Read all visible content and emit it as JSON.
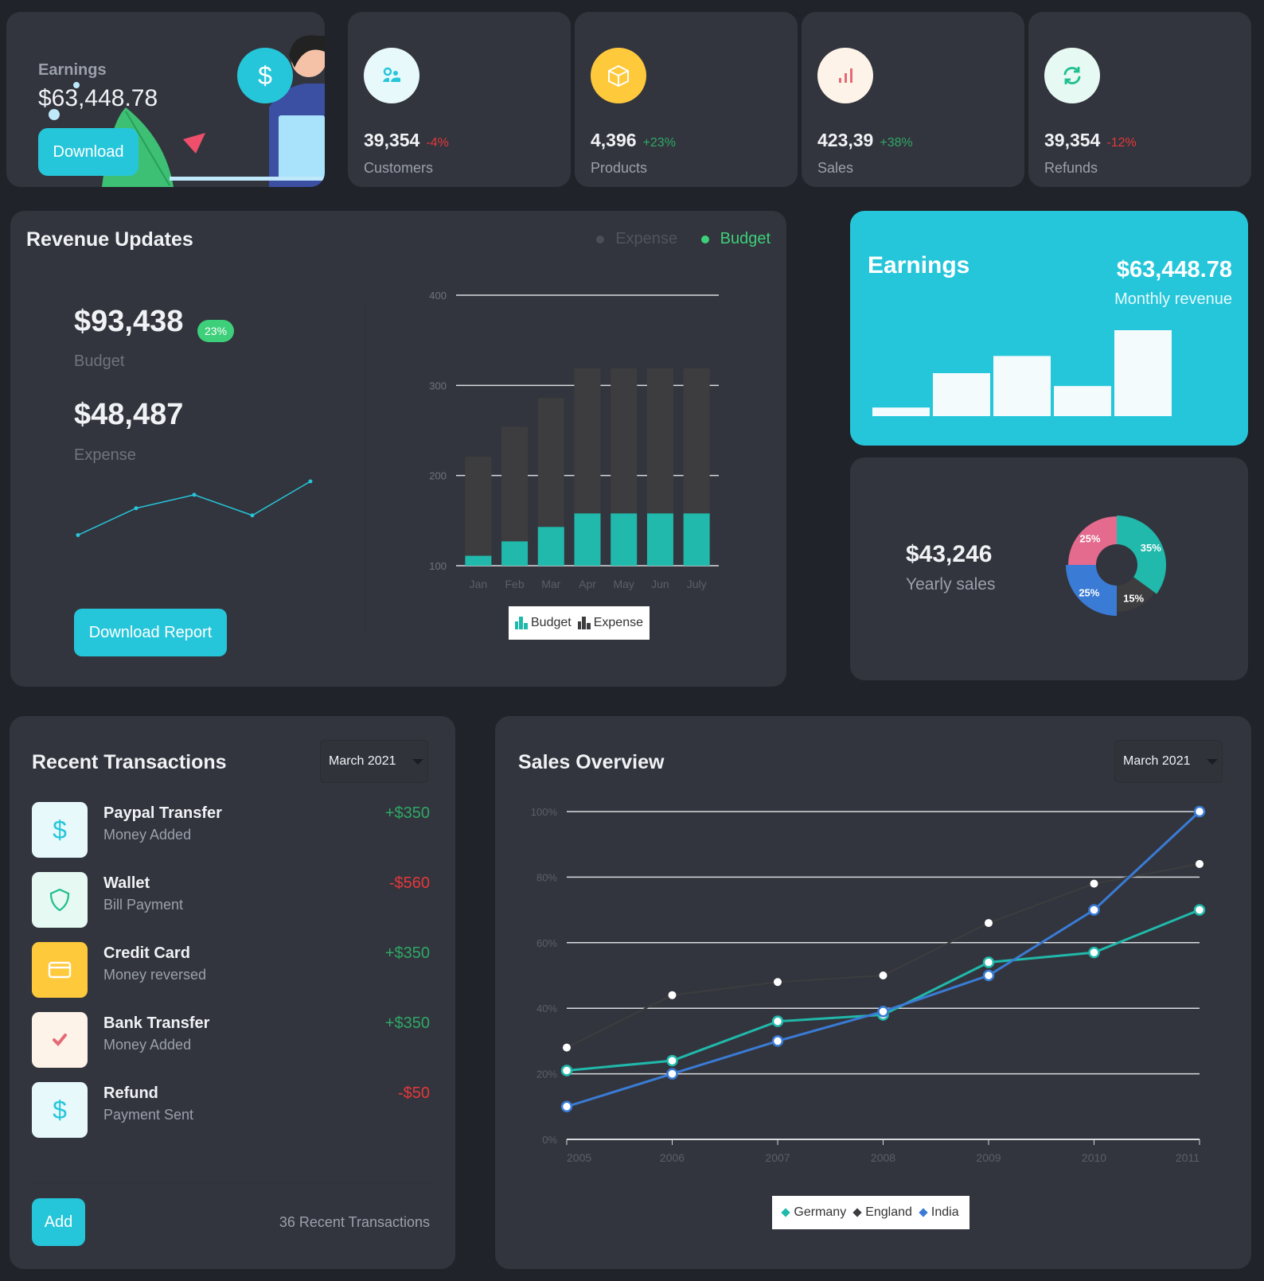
{
  "earnings_card": {
    "label": "Earnings",
    "value": "$63,448.78",
    "button": "Download",
    "icon": "dollar-icon"
  },
  "stats": [
    {
      "value": "39,354",
      "change": "-4%",
      "trend": "down",
      "label": "Customers",
      "icon": "users-icon",
      "icon_bg": "#e8f9fc",
      "icon_color": "#26c6da"
    },
    {
      "value": "4,396",
      "change": "+23%",
      "trend": "up",
      "label": "Products",
      "icon": "box-icon",
      "icon_bg": "#ffc93c",
      "icon_color": "#ffffff"
    },
    {
      "value": "423,39",
      "change": "+38%",
      "trend": "up",
      "label": "Sales",
      "icon": "bar-chart-icon",
      "icon_bg": "#fef3e8",
      "icon_color": "#e46a76"
    },
    {
      "value": "39,354",
      "change": "-12%",
      "trend": "down",
      "label": "Refunds",
      "icon": "refresh-icon",
      "icon_bg": "#e6f9f2",
      "icon_color": "#1fbf8f"
    }
  ],
  "revenue": {
    "title": "Revenue Updates",
    "legend_top": [
      {
        "label": "Expense",
        "color": "#4a4f57"
      },
      {
        "label": "Budget",
        "color": "#3ecf7a"
      }
    ],
    "budget_value": "$93,438",
    "budget_badge": "23%",
    "budget_label": "Budget",
    "expense_value": "$48,487",
    "expense_label": "Expense",
    "button": "Download Report"
  },
  "earnings_monthly": {
    "title": "Earnings",
    "value": "$63,448.78",
    "subtitle": "Monthly revenue"
  },
  "yearly": {
    "value": "$43,246",
    "label": "Yearly sales"
  },
  "transactions": {
    "title": "Recent Transactions",
    "period": "March 2021",
    "items": [
      {
        "name": "Paypal Transfer",
        "sub": "Money Added",
        "amount": "+$350",
        "type": "credit",
        "icon": "dollar-icon",
        "icon_bg": "#e8f9fc",
        "icon_color": "#26c6da"
      },
      {
        "name": "Wallet",
        "sub": "Bill Payment",
        "amount": "-$560",
        "type": "debit",
        "icon": "shield-icon",
        "icon_bg": "#e6f9f2",
        "icon_color": "#1fbf8f"
      },
      {
        "name": "Credit Card",
        "sub": "Money reversed",
        "amount": "+$350",
        "type": "credit",
        "icon": "credit-card-icon",
        "icon_bg": "#ffc93c",
        "icon_color": "#ffffff"
      },
      {
        "name": "Bank Transfer",
        "sub": "Money Added",
        "amount": "+$350",
        "type": "credit",
        "icon": "check-icon",
        "icon_bg": "#fef3e8",
        "icon_color": "#e46a76"
      },
      {
        "name": "Refund",
        "sub": "Payment Sent",
        "amount": "-$50",
        "type": "debit",
        "icon": "dollar-icon",
        "icon_bg": "#e8f9fc",
        "icon_color": "#26c6da"
      }
    ],
    "add_button": "Add",
    "footer": "36 Recent Transactions"
  },
  "sales_overview": {
    "title": "Sales Overview",
    "period": "March 2021"
  },
  "chart_data": [
    {
      "id": "revenue-bars",
      "type": "bar",
      "stacked": true,
      "categories": [
        "Jan",
        "Feb",
        "Mar",
        "Apr",
        "May",
        "Jun",
        "July"
      ],
      "series": [
        {
          "name": "Budget",
          "color": "#20b9ab",
          "values": [
            11,
            27,
            43,
            58,
            58,
            58,
            58
          ]
        },
        {
          "name": "Expense",
          "color": "#3d3d3f",
          "values": [
            110,
            127,
            143,
            161,
            161,
            161,
            161
          ]
        }
      ],
      "baseline": 100,
      "yticks": [
        100,
        200,
        300,
        400
      ],
      "ylim": [
        100,
        400
      ],
      "grid": true,
      "legend": [
        "Budget",
        "Expense"
      ],
      "legend_position": "bottom"
    },
    {
      "id": "revenue-sparkline",
      "type": "line",
      "values": [
        2,
        5,
        6.5,
        4.2,
        8
      ],
      "color": "#26c6da"
    },
    {
      "id": "monthly-bars",
      "type": "bar",
      "values": [
        1,
        5,
        7,
        3.5,
        10
      ],
      "color": "#f3fbfd"
    },
    {
      "id": "yearly-donut",
      "type": "pie",
      "slices": [
        {
          "label": "35%",
          "value": 35,
          "color": "#20b9ab"
        },
        {
          "label": "15%",
          "value": 15,
          "color": "#3d3d3f"
        },
        {
          "label": "25%",
          "value": 25,
          "color": "#3a7bd5"
        },
        {
          "label": "25%",
          "value": 25,
          "color": "#e46a8e"
        }
      ]
    },
    {
      "id": "sales-lines",
      "type": "line",
      "x": [
        "2005",
        "2006",
        "2007",
        "2008",
        "2009",
        "2010",
        "2011"
      ],
      "series": [
        {
          "name": "Germany",
          "color": "#20b9ab",
          "values": [
            21,
            24,
            36,
            38,
            54,
            57,
            70
          ]
        },
        {
          "name": "England",
          "color": "#3d3d3f",
          "values": [
            28,
            44,
            48,
            50,
            66,
            78,
            84
          ]
        },
        {
          "name": "India",
          "color": "#3a7bd5",
          "values": [
            10,
            20,
            30,
            39,
            50,
            70,
            100
          ]
        }
      ],
      "yticks": [
        "0%",
        "20%",
        "40%",
        "60%",
        "80%",
        "100%"
      ],
      "ylim": [
        0,
        100
      ],
      "grid": true,
      "legend_position": "bottom"
    }
  ]
}
